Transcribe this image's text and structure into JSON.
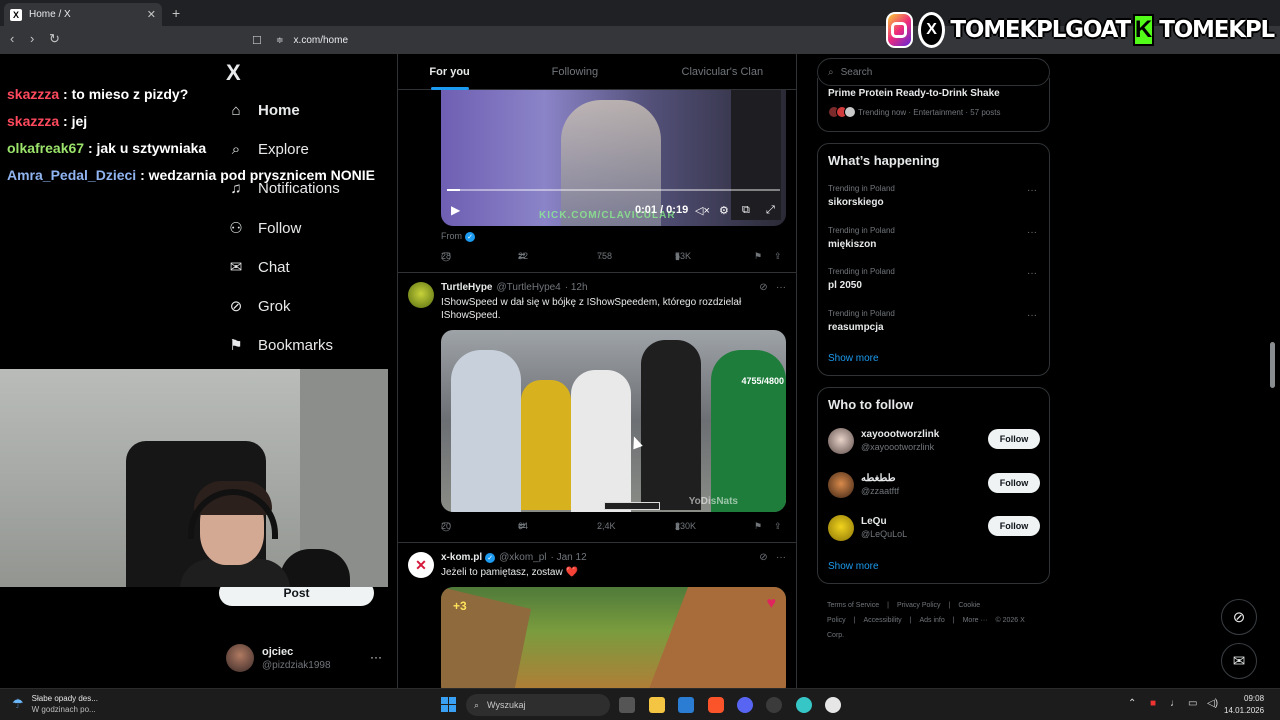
{
  "browser": {
    "tab_title": "Home / X",
    "tab_favicon": "X",
    "url": "x.com/home"
  },
  "stream_overlay": {
    "banner_text": "TOMEKPLGOAT",
    "banner_text_2": "TOMEKPL",
    "kick_letter": "K",
    "chat": [
      {
        "user": "skazzza",
        "message": ": to mieso z pizdy?",
        "color": "#ff4a5e"
      },
      {
        "user": "skazzza",
        "message": ": jej",
        "color": "#ff4a5e"
      },
      {
        "user": "olkafreak67",
        "message": ": jak u sztywniaka",
        "color": "#9be36b"
      },
      {
        "user": "Amra_Pedal_Dzieci",
        "message": ": wedzarnia pod prysznicem NONIE",
        "color": "#8fb4f0"
      }
    ]
  },
  "left_nav": {
    "logo": "X",
    "items": [
      {
        "label": "Home",
        "icon": "home-icon",
        "glyph": "⌂"
      },
      {
        "label": "Explore",
        "icon": "search-icon",
        "glyph": "⌕"
      },
      {
        "label": "Notifications",
        "icon": "bell-icon",
        "glyph": "♫"
      },
      {
        "label": "Follow",
        "icon": "person-add-icon",
        "glyph": "⚇"
      },
      {
        "label": "Chat",
        "icon": "mail-icon",
        "glyph": "✉"
      },
      {
        "label": "Grok",
        "icon": "grok-icon",
        "glyph": "⊘"
      },
      {
        "label": "Bookmarks",
        "icon": "bookmark-icon",
        "glyph": "⚑"
      }
    ],
    "post_button": "Post",
    "account": {
      "name": "ojciec",
      "handle": "@pizdziak1998",
      "more": "···"
    }
  },
  "timeline": {
    "tabs": [
      "For you",
      "Following",
      "Clavicular's Clan"
    ],
    "active_tab": "For you",
    "post1": {
      "video_time": "0:01 / 0:19",
      "watermark": "KICK.COM/CLAVICULAR",
      "from_label": "From",
      "replies": "28",
      "reposts": "22",
      "likes": "758",
      "views": "53K",
      "progress": 0.04
    },
    "post2": {
      "name": "TurtleHype",
      "handle": "@TurtleHype4",
      "time": "· 12h",
      "text": "IShowSpeed w dał się w bójkę z IShowSpeedem, którego rozdzielał IShowSpeed.",
      "video_counter": "4755/4800",
      "video_watermark": "YoDisNats",
      "replies": "20",
      "reposts": "64",
      "likes": "2,4K",
      "views": "230K"
    },
    "post3": {
      "name": "x-kom.pl",
      "handle": "@xkom_pl",
      "time": "· Jan 12",
      "text": "Jeżeli to pamiętasz, zostaw ❤️",
      "image_badge": "+3"
    }
  },
  "right_sidebar": {
    "search_placeholder": "Search",
    "promo": {
      "title": "Prime Protein Ready-to-Drink Shake",
      "meta": "Trending now · Entertainment · 57 posts"
    },
    "whats_happening": {
      "title": "What’s happening",
      "trends": [
        {
          "meta": "Trending in Poland",
          "name": "sikorskiego"
        },
        {
          "meta": "Trending in Poland",
          "name": "miękiszon"
        },
        {
          "meta": "Trending in Poland",
          "name": "pl 2050"
        },
        {
          "meta": "Trending in Poland",
          "name": "reasumpcja"
        }
      ],
      "show_more": "Show more"
    },
    "who_to_follow": {
      "title": "Who to follow",
      "users": [
        {
          "name": "xayoootworzlink",
          "handle": "@xayoootworzlink",
          "button": "Follow"
        },
        {
          "name": "ططغطه",
          "handle": "@zzaatftf",
          "button": "Follow"
        },
        {
          "name": "LeQu",
          "handle": "@LeQuLoL",
          "button": "Follow"
        }
      ],
      "show_more": "Show more"
    },
    "footer": [
      "Terms of Service",
      "|",
      "Privacy Policy",
      "|",
      "Cookie Policy",
      "|",
      "Accessibility",
      "|",
      "Ads info",
      "|",
      "More ···",
      "© 2026 X Corp."
    ]
  },
  "taskbar": {
    "weather_line1": "Słabe opady des...",
    "weather_line2": "W godzinach po...",
    "search_placeholder": "Wyszukaj",
    "time": "09:08",
    "date": "14.01.2026"
  }
}
